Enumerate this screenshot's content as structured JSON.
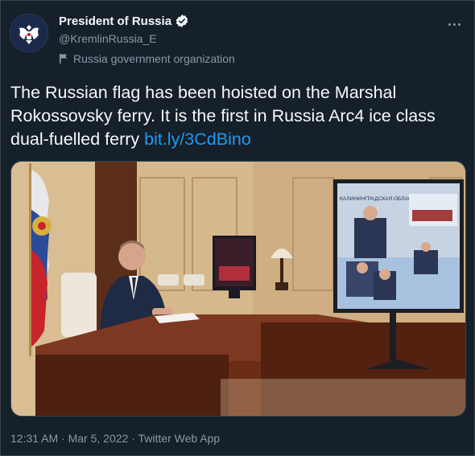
{
  "account": {
    "name": "President of Russia",
    "handle": "@KremlinRussia_E",
    "label": "Russia government organization",
    "verified": true
  },
  "tweet": {
    "text": "The Russian flag has been hoisted on the Marshal Rokossovsky ferry. It is the first in Russia Arc4 ice class dual-fuelled ferry ",
    "link": "bit.ly/3CdBino",
    "timestamp": "12:31 AM · Mar 5, 2022 · ",
    "app": "Twitter Web App"
  },
  "photo": {
    "screen_caption": "КАЛИНИНГРАДСКАЯ ОБЛАСТЬ"
  },
  "colors": {
    "background": "#15202b",
    "text": "#f7f9f9",
    "secondary": "#8b98a5",
    "link": "#1d9bf0"
  },
  "icons": {
    "verified": "verified-badge-icon",
    "label": "flag-icon",
    "more": "more-icon",
    "avatar": "double-headed-eagle-icon"
  }
}
